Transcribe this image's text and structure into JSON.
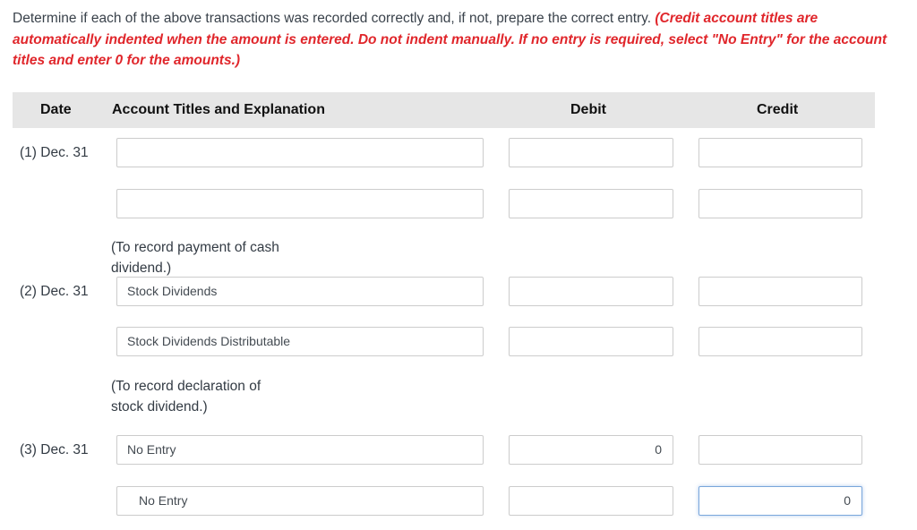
{
  "instructions": {
    "main": "Determine if each of the above transactions was recorded correctly and, if not, prepare the correct entry.",
    "note": "(Credit account titles are automatically indented when the amount is entered. Do not indent manually. If no entry is required, select \"No Entry\" for the account titles and enter 0 for the amounts.)"
  },
  "table": {
    "headers": {
      "date": "Date",
      "account": "Account Titles and Explanation",
      "debit": "Debit",
      "credit": "Credit"
    },
    "entries": [
      {
        "date": "(1) Dec. 31",
        "rows": [
          {
            "account": "",
            "debit": "",
            "credit": ""
          },
          {
            "account": "",
            "debit": "",
            "credit": ""
          }
        ],
        "explanation": "(To record payment of cash dividend.)"
      },
      {
        "date": "(2) Dec. 31",
        "rows": [
          {
            "account": "Stock Dividends",
            "debit": "",
            "credit": ""
          },
          {
            "account": "Stock Dividends Distributable",
            "debit": "",
            "credit": ""
          }
        ],
        "explanation": "(To record declaration of stock dividend.)"
      },
      {
        "date": "(3) Dec. 31",
        "rows": [
          {
            "account": "No Entry",
            "debit": "0",
            "credit": ""
          },
          {
            "account": "No Entry",
            "debit": "",
            "credit": "0"
          }
        ]
      }
    ]
  }
}
